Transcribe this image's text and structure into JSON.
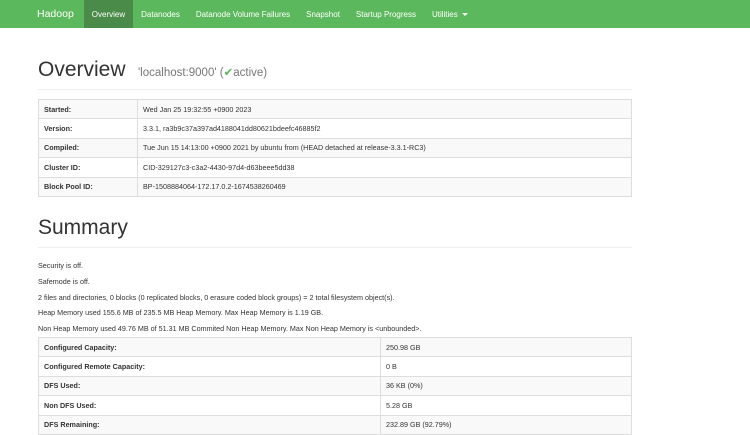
{
  "navbar": {
    "brand": "Hadoop",
    "items": [
      {
        "label": "Overview"
      },
      {
        "label": "Datanodes"
      },
      {
        "label": "Datanode Volume Failures"
      },
      {
        "label": "Snapshot"
      },
      {
        "label": "Startup Progress"
      },
      {
        "label": "Utilities"
      }
    ]
  },
  "overview": {
    "title": "Overview",
    "host": "'localhost:9000'",
    "status_prefix": "(",
    "status_check": "✔",
    "status_text": "active)"
  },
  "info_rows": [
    {
      "key": "Started:",
      "value": "Wed Jan 25 19:32:55 +0900 2023"
    },
    {
      "key": "Version:",
      "value": "3.3.1, ra3b9c37a397ad4188041dd80621bdeefc46885f2"
    },
    {
      "key": "Compiled:",
      "value": "Tue Jun 15 14:13:00 +0900 2021 by ubuntu from (HEAD detached at release-3.3.1-RC3)"
    },
    {
      "key": "Cluster ID:",
      "value": "CID-329127c3-c3a2-4430-97d4-d63beee5dd38"
    },
    {
      "key": "Block Pool ID:",
      "value": "BP-1508884064-172.17.0.2-1674538260469"
    }
  ],
  "summary": {
    "title": "Summary",
    "lines": [
      "Security is off.",
      "Safemode is off.",
      "2 files and directories, 0 blocks (0 replicated blocks, 0 erasure coded block groups) = 2 total filesystem object(s).",
      "Heap Memory used 155.6 MB of 235.5 MB Heap Memory. Max Heap Memory is 1.19 GB.",
      "Non Heap Memory used 49.76 MB of 51.31 MB Commited Non Heap Memory. Max Non Heap Memory is <unbounded>."
    ],
    "rows": [
      {
        "key": "Configured Capacity:",
        "value": "250.98 GB"
      },
      {
        "key": "Configured Remote Capacity:",
        "value": "0 B"
      },
      {
        "key": "DFS Used:",
        "value": "36 KB (0%)"
      },
      {
        "key": "Non DFS Used:",
        "value": "5.28 GB"
      },
      {
        "key": "DFS Remaining:",
        "value": "232.89 GB (92.79%)"
      }
    ]
  }
}
